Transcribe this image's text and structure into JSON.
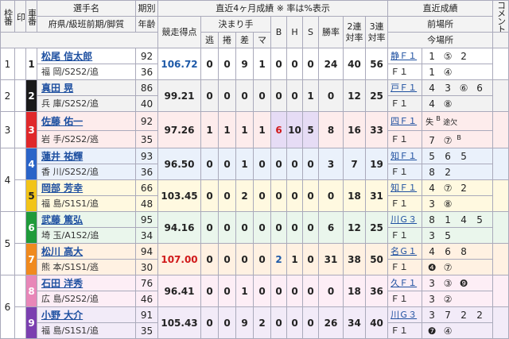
{
  "header": {
    "waku": "枠番",
    "shirushi": "印",
    "shaban": "車番",
    "player_top": "選手名",
    "player_bottom": "府県/級班前期/脚質",
    "period_top": "期別",
    "period_bottom": "年齢",
    "recent_title": "直近4ヶ月成績 ※ 率は%表示",
    "score": "競走得点",
    "kimarite": "決まり手",
    "k1": "逃",
    "k2": "捲",
    "k3": "差",
    "k4": "マ",
    "b": "B",
    "h": "H",
    "s": "S",
    "win": "勝率",
    "ren2_top": "2連",
    "ren2_bottom": "対率",
    "ren3_top": "3連",
    "ren3_bottom": "対率",
    "recent_results": "直近成績",
    "prev_venue": "前場所",
    "cur_venue": "今場所",
    "comment": "コメント"
  },
  "frame_labels": [
    "1",
    "2",
    "3",
    "4",
    "5",
    "6"
  ],
  "riders": [
    {
      "car": "1",
      "name": "松尾 信太郎",
      "pref": "福 岡/S2S2/追",
      "period": "92",
      "age": "36",
      "score": "106.72",
      "score_color": "blue",
      "k": [
        "0",
        "0",
        "9",
        "1"
      ],
      "b": "0",
      "h": "0",
      "s": "0",
      "win": "24",
      "r2": "40",
      "r3": "56",
      "prev_venue": "静Ｆ１",
      "prev_ranks": [
        "1",
        "⑤",
        "2"
      ],
      "cur_venue": "Ｆ１",
      "cur_ranks": [
        "1",
        "④"
      ],
      "car_bg": "#ffffff",
      "car_fg": "#222222",
      "row_bg": "#ffffff"
    },
    {
      "car": "2",
      "name": "真田 晃",
      "pref": "兵 庫/S2S2/追",
      "period": "86",
      "age": "40",
      "score": "99.21",
      "score_color": "",
      "k": [
        "0",
        "0",
        "0",
        "0"
      ],
      "b": "0",
      "h": "0",
      "s": "1",
      "win": "0",
      "r2": "12",
      "r3": "25",
      "prev_venue": "戸Ｆ１",
      "prev_ranks": [
        "4",
        "3",
        "⑥",
        "6"
      ],
      "cur_venue": "Ｆ１",
      "cur_ranks": [
        "4",
        "⑧"
      ],
      "car_bg": "#1a1a1a",
      "car_fg": "#ffffff",
      "row_bg": "#f2f2f2"
    },
    {
      "car": "3",
      "name": "佐藤 佑一",
      "pref": "岩 手/S2S2/逃",
      "period": "92",
      "age": "35",
      "score": "97.26",
      "score_color": "",
      "k": [
        "1",
        "1",
        "1",
        "1"
      ],
      "b": "6",
      "h": "10",
      "s": "5",
      "win": "8",
      "r2": "16",
      "r3": "33",
      "prev_venue": "四Ｆ１",
      "prev_ranks": [
        "失",
        "B",
        "途欠"
      ],
      "cur_venue": "Ｆ１",
      "cur_ranks": [
        "7",
        "⑦",
        "B"
      ],
      "car_bg": "#e0282a",
      "car_fg": "#ffffff",
      "row_bg": "#fdecec"
    },
    {
      "car": "4",
      "name": "蓮井 祐輝",
      "pref": "香 川/S2S2/追",
      "period": "93",
      "age": "36",
      "score": "96.50",
      "score_color": "",
      "k": [
        "0",
        "0",
        "1",
        "0"
      ],
      "b": "0",
      "h": "0",
      "s": "0",
      "win": "3",
      "r2": "7",
      "r3": "19",
      "prev_venue": "知Ｆ１",
      "prev_ranks": [
        "5",
        "6",
        "5"
      ],
      "cur_venue": "Ｆ１",
      "cur_ranks": [
        "8",
        "2"
      ],
      "car_bg": "#2a64c8",
      "car_fg": "#ffffff",
      "row_bg": "#eaf1fb"
    },
    {
      "car": "5",
      "name": "岡部 芳幸",
      "pref": "福 島/S1S1/追",
      "period": "66",
      "age": "48",
      "score": "103.45",
      "score_color": "",
      "k": [
        "0",
        "0",
        "2",
        "0"
      ],
      "b": "0",
      "h": "0",
      "s": "0",
      "win": "0",
      "r2": "18",
      "r3": "31",
      "prev_venue": "知Ｆ１",
      "prev_ranks": [
        "4",
        "⑦",
        "2"
      ],
      "cur_venue": "Ｆ１",
      "cur_ranks": [
        "3",
        "⑧"
      ],
      "car_bg": "#f2c418",
      "car_fg": "#222222",
      "row_bg": "#fff9e0"
    },
    {
      "car": "6",
      "name": "武藤 篤弘",
      "pref": "埼 玉/A1S2/追",
      "period": "95",
      "age": "34",
      "score": "94.16",
      "score_color": "",
      "k": [
        "0",
        "0",
        "0",
        "0"
      ],
      "b": "0",
      "h": "0",
      "s": "0",
      "win": "6",
      "r2": "12",
      "r3": "25",
      "prev_venue": "川Ｇ３",
      "prev_ranks": [
        "8",
        "1",
        "4",
        "5"
      ],
      "cur_venue": "Ｆ１",
      "cur_ranks": [
        "3",
        "5"
      ],
      "car_bg": "#1f9a3a",
      "car_fg": "#ffffff",
      "row_bg": "#eaf6ec"
    },
    {
      "car": "7",
      "name": "松川 高大",
      "pref": "熊 本/S1S1/逃",
      "period": "94",
      "age": "30",
      "score": "107.00",
      "score_color": "red",
      "k": [
        "0",
        "0",
        "0",
        "0"
      ],
      "b": "2",
      "h": "1",
      "s": "0",
      "win": "31",
      "r2": "38",
      "r3": "50",
      "prev_venue": "名Ｇ１",
      "prev_ranks": [
        "4",
        "6",
        "8"
      ],
      "cur_venue": "Ｆ１",
      "cur_ranks": [
        "❹",
        "⑦"
      ],
      "car_bg": "#f08a1e",
      "car_fg": "#ffffff",
      "row_bg": "#fff1e2"
    },
    {
      "car": "8",
      "name": "石田 洋秀",
      "pref": "広 島/S2S2/追",
      "period": "76",
      "age": "46",
      "score": "96.41",
      "score_color": "",
      "k": [
        "0",
        "0",
        "1",
        "0"
      ],
      "b": "0",
      "h": "0",
      "s": "0",
      "win": "0",
      "r2": "18",
      "r3": "36",
      "prev_venue": "久Ｆ１",
      "prev_ranks": [
        "3",
        "③",
        "❾"
      ],
      "cur_venue": "Ｆ１",
      "cur_ranks": [
        "3",
        "②"
      ],
      "car_bg": "#e887b8",
      "car_fg": "#ffffff",
      "row_bg": "#fdeef6"
    },
    {
      "car": "9",
      "name": "小野 大介",
      "pref": "福 島/S1S1/追",
      "period": "91",
      "age": "35",
      "score": "105.43",
      "score_color": "",
      "k": [
        "0",
        "0",
        "9",
        "2"
      ],
      "b": "0",
      "h": "0",
      "s": "0",
      "win": "26",
      "r2": "34",
      "r3": "40",
      "prev_venue": "川Ｇ３",
      "prev_ranks": [
        "3",
        "7",
        "2",
        "2"
      ],
      "cur_venue": "Ｆ１",
      "cur_ranks": [
        "❼",
        "④"
      ],
      "car_bg": "#7b3fb0",
      "car_fg": "#ffffff",
      "row_bg": "#f2ebf8"
    }
  ]
}
